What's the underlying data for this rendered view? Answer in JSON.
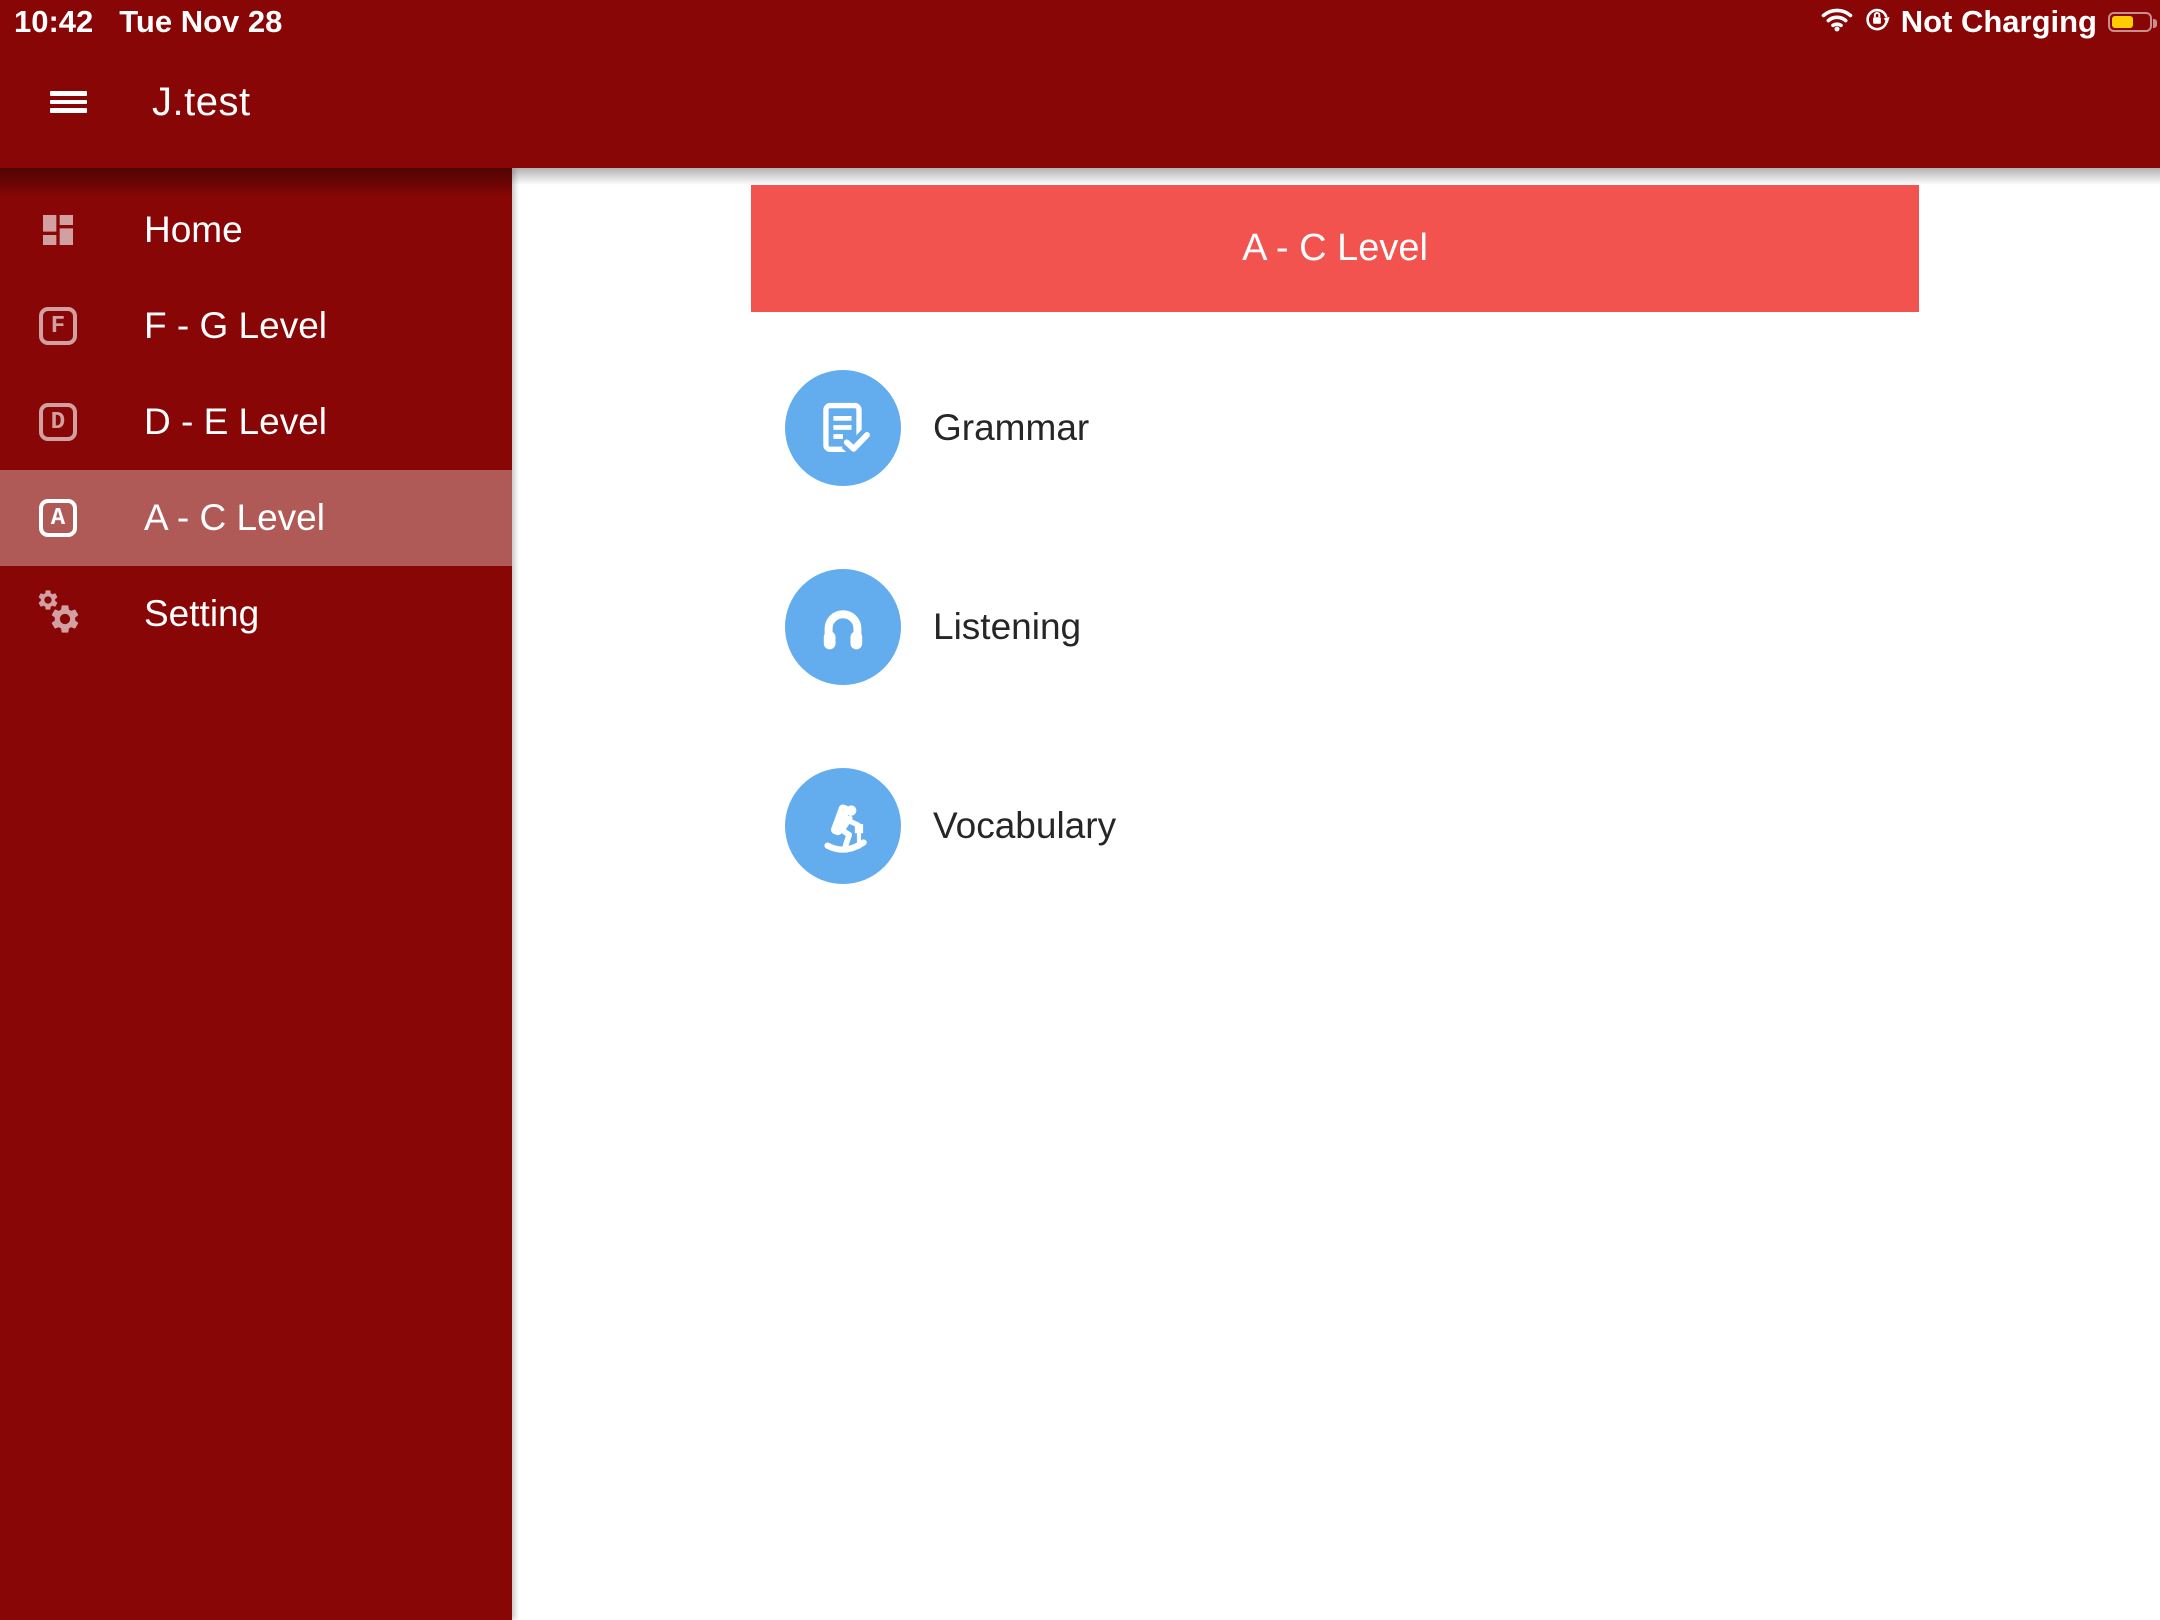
{
  "status_bar": {
    "time": "10:42",
    "date": "Tue Nov 28",
    "battery_status": "Not Charging",
    "battery_fill_percent": 52,
    "icons": [
      "wifi-icon",
      "rotation-lock-icon",
      "battery-icon"
    ]
  },
  "header": {
    "title": "J.test",
    "icons": [
      "hamburger-menu-icon"
    ]
  },
  "sidebar": {
    "selected_index": 3,
    "items": [
      {
        "label": "Home",
        "icon": "dashboard-icon"
      },
      {
        "label": "F - G Level",
        "icon": "letter-f-icon"
      },
      {
        "label": "D - E Level",
        "icon": "letter-d-icon"
      },
      {
        "label": "A - C Level",
        "icon": "letter-a-icon"
      },
      {
        "label": "Setting",
        "icon": "gears-icon"
      }
    ]
  },
  "main": {
    "banner_title": "A - C Level",
    "courses": [
      {
        "label": "Grammar",
        "icon": "grammar-checklist-icon"
      },
      {
        "label": "Listening",
        "icon": "headphones-icon"
      },
      {
        "label": "Vocabulary",
        "icon": "skier-icon"
      }
    ]
  },
  "colors": {
    "top_red": "#880606",
    "selected_item_bg": "#B05A57",
    "banner_red": "#F3534F",
    "course_icon_blue": "#63ADEF",
    "battery_yellow": "#FFCC00"
  }
}
